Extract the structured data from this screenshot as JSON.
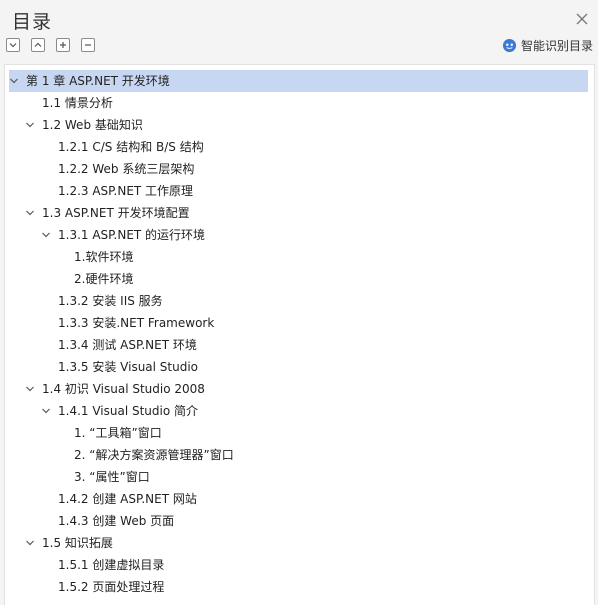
{
  "title": "目录",
  "smart_label": "智能识别目录",
  "toolbar": {
    "buttons": [
      {
        "name": "expand-all-button",
        "icon": "chevron-down-icon"
      },
      {
        "name": "collapse-all-button",
        "icon": "chevron-up-icon"
      },
      {
        "name": "add-entry-button",
        "icon": "plus-icon"
      },
      {
        "name": "remove-entry-button",
        "icon": "minus-icon"
      }
    ]
  },
  "colors": {
    "selected": "#c7d7f2",
    "accent": "#3a7bd5"
  },
  "items": [
    {
      "label": "第 1 章  ASP.NET 开发环境",
      "level": 0,
      "expandable": true,
      "selected": true
    },
    {
      "label": "1.1  情景分析",
      "level": 1,
      "expandable": false
    },
    {
      "label": "1.2  Web 基础知识",
      "level": 1,
      "expandable": true
    },
    {
      "label": "1.2.1  C/S 结构和 B/S 结构",
      "level": 2,
      "expandable": false
    },
    {
      "label": "1.2.2  Web 系统三层架构",
      "level": 2,
      "expandable": false
    },
    {
      "label": "1.2.3  ASP.NET 工作原理",
      "level": 2,
      "expandable": false
    },
    {
      "label": "1.3  ASP.NET 开发环境配置",
      "level": 1,
      "expandable": true
    },
    {
      "label": "1.3.1  ASP.NET 的运行环境",
      "level": 2,
      "expandable": true
    },
    {
      "label": "1.软件环境",
      "level": 3,
      "expandable": false
    },
    {
      "label": "2.硬件环境",
      "level": 3,
      "expandable": false
    },
    {
      "label": "1.3.2  安装 IIS 服务",
      "level": 2,
      "expandable": false
    },
    {
      "label": "1.3.3  安装.NET  Framework",
      "level": 2,
      "expandable": false
    },
    {
      "label": "1.3.4  测试 ASP.NET 环境",
      "level": 2,
      "expandable": false
    },
    {
      "label": "1.3.5  安装 Visual  Studio",
      "level": 2,
      "expandable": false
    },
    {
      "label": "1.4  初识 Visual  Studio  2008",
      "level": 1,
      "expandable": true
    },
    {
      "label": "1.4.1  Visual  Studio 简介",
      "level": 2,
      "expandable": true
    },
    {
      "label": "1. “工具箱”窗口",
      "level": 3,
      "expandable": false
    },
    {
      "label": "2. “解决方案资源管理器”窗口",
      "level": 3,
      "expandable": false
    },
    {
      "label": "3. “属性”窗口",
      "level": 3,
      "expandable": false
    },
    {
      "label": "1.4.2  创建 ASP.NET 网站",
      "level": 2,
      "expandable": false
    },
    {
      "label": "1.4.3  创建 Web 页面",
      "level": 2,
      "expandable": false
    },
    {
      "label": "1.5  知识拓展",
      "level": 1,
      "expandable": true
    },
    {
      "label": "1.5.1  创建虚拟目录",
      "level": 2,
      "expandable": false
    },
    {
      "label": "1.5.2  页面处理过程",
      "level": 2,
      "expandable": false
    }
  ]
}
